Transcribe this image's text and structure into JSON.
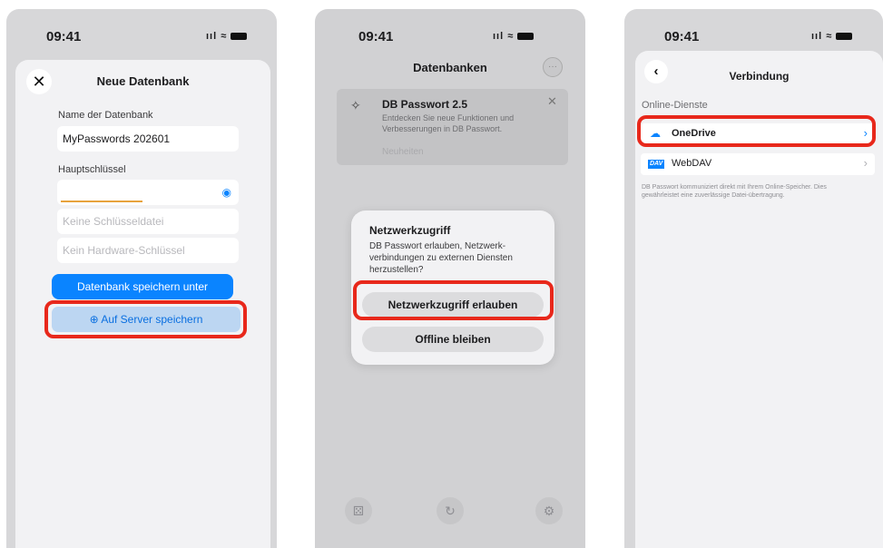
{
  "status": {
    "time": "09:41"
  },
  "screen1": {
    "title": "Neue Datenbank",
    "db_name_label": "Name der Datenbank",
    "db_name_value": "MyPasswords 202601",
    "master_key_label": "Hauptschlüssel",
    "key_file_placeholder": "Keine Schlüsseldatei",
    "hardware_key_placeholder": "Kein Hardware-Schlüssel",
    "save_as_label": "Datenbank speichern unter",
    "save_server_label": "Auf Server speichern"
  },
  "screen2": {
    "title": "Datenbanken",
    "banner_title": "DB Passwort 2.5",
    "banner_text": "Entdecken Sie neue Funktionen und Verbesserungen in DB Passwort.",
    "banner_link": "Neuheiten",
    "dialog_title": "Netzwerkzugriff",
    "dialog_text": "DB Passwort erlauben, Netzwerk-verbindungen zu externen Diensten herzustellen?",
    "allow_label": "Netzwerkzugriff erlauben",
    "offline_label": "Offline bleiben"
  },
  "screen3": {
    "title": "Verbindung",
    "section_label": "Online-Dienste",
    "onedrive_label": "OneDrive",
    "webdav_label": "WebDAV",
    "webdav_badge": "DAV",
    "footer_text": "DB Passwort kommuniziert direkt mit Ihrem Online-Speicher. Dies gewährleistet eine zuverlässige Datei-übertragung."
  },
  "colors": {
    "accent": "#0a84ff",
    "highlight": "#e8281b",
    "orange": "#e8a33d"
  }
}
